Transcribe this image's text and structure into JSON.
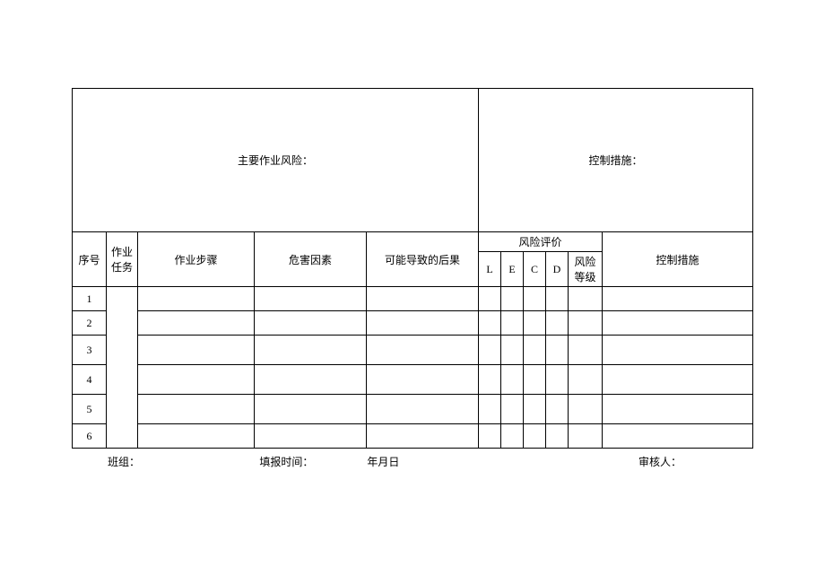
{
  "top": {
    "main_risk_label": "主要作业风险：",
    "control_label": "控制措施："
  },
  "headers": {
    "seq": "序号",
    "task": "作业任务",
    "step": "作业步骤",
    "hazard": "危害因素",
    "consequence": "可能导致的后果",
    "eval_group": "风险评价",
    "L": "L",
    "E": "E",
    "C": "C",
    "D": "D",
    "level": "风险等级",
    "control": "控制措施"
  },
  "rows": [
    {
      "no": "1"
    },
    {
      "no": "2"
    },
    {
      "no": "3"
    },
    {
      "no": "4"
    },
    {
      "no": "5"
    },
    {
      "no": "6"
    }
  ],
  "footer": {
    "team": "班组：",
    "report_time": "填报时间：",
    "date": "年月日",
    "reviewer": "审核人："
  }
}
